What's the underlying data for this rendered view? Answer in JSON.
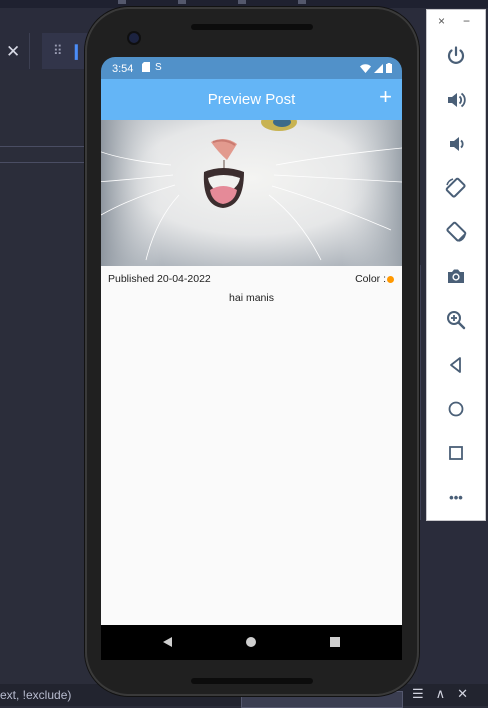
{
  "ide": {
    "close_glyph": "✕",
    "grip_glyph": "⠿",
    "pause_glyph": "❙❙",
    "status_text": "ext, !exclude)"
  },
  "emulator": {
    "close_glyph": "×",
    "minimize_glyph": "−",
    "more_glyph": "•••",
    "icons": [
      "power-icon",
      "volume-up-icon",
      "volume-down-icon",
      "rotate-left-icon",
      "rotate-right-icon",
      "camera-icon",
      "zoom-icon",
      "back-icon",
      "home-icon",
      "overview-icon",
      "more-icon"
    ],
    "icon_color": "#4a5f77"
  },
  "phone": {
    "status": {
      "time": "3:54",
      "sim_label": "S"
    },
    "appbar": {
      "title": "Preview Post",
      "add_glyph": "+",
      "color": "#64b5f6"
    },
    "post": {
      "published": "Published 20-04-2022",
      "color_label": "Color :",
      "color_value": "#ff9800",
      "description": "hai manis"
    }
  }
}
